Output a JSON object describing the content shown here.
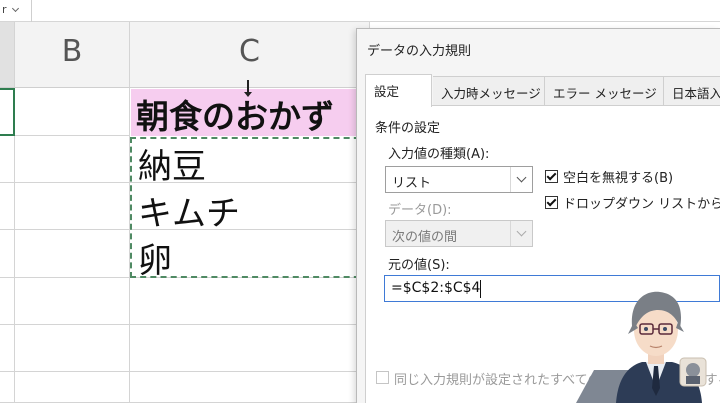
{
  "sheet": {
    "name_box": "r",
    "columns": [
      "B",
      "C"
    ],
    "header_cell": "朝食のおかず",
    "rows": [
      "納豆",
      "キムチ",
      "卵"
    ]
  },
  "dialog": {
    "title": "データの入力規則",
    "tabs": [
      "設定",
      "入力時メッセージ",
      "エラー メッセージ",
      "日本語入力"
    ],
    "section_label": "条件の設定",
    "allow_label": "入力値の種類(A):",
    "allow_value": "リスト",
    "data_label": "データ(D):",
    "data_value": "次の値の間",
    "ignore_blank_label": "空白を無視する(B)",
    "dropdown_label": "ドロップダウン リストから選択す",
    "source_label": "元の値(S):",
    "source_value": "=$C$2:$C$4",
    "apply_all_label": "同じ入力規則が設定されたすべてのセルに変更を適用する"
  },
  "colors": {
    "header_fill": "#f6cdef",
    "marching_ants": "#4f8a63",
    "focus_border": "#3f7ad6"
  },
  "icons": [
    "chevron-down-icon",
    "checkbox-check-icon",
    "avatar-character"
  ]
}
